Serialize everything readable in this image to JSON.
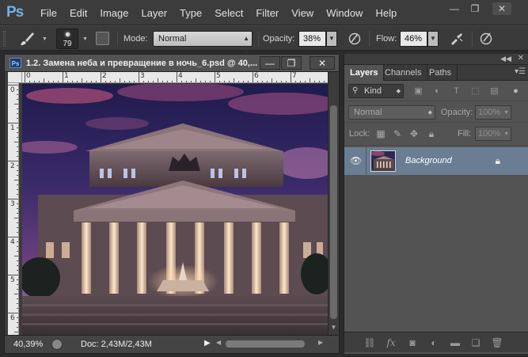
{
  "app": {
    "logo": "Ps",
    "menu": [
      "File",
      "Edit",
      "Image",
      "Layer",
      "Type",
      "Select",
      "Filter",
      "View",
      "Window",
      "Help"
    ],
    "window_controls": {
      "minimize": "—",
      "restore": "❐",
      "close": "✕"
    }
  },
  "options": {
    "brush_size": "79",
    "mode_label": "Mode:",
    "mode_value": "Normal",
    "opacity_label": "Opacity:",
    "opacity_value": "38%",
    "flow_label": "Flow:",
    "flow_value": "46%"
  },
  "document": {
    "title": "1.2. Замена неба и превращение в ночь_6.psd @ 40,...",
    "zoom": "40,39%",
    "doc_info": "Doc: 2,43M/2,43M",
    "ruler_top": [
      "0",
      "1",
      "2",
      "3",
      "4",
      "5",
      "6",
      "7"
    ],
    "ruler_left": [
      "0",
      "1",
      "2",
      "3",
      "4",
      "5",
      "6"
    ]
  },
  "layers_panel": {
    "tabs": [
      "Layers",
      "Channels",
      "Paths"
    ],
    "active_tab": "Layers",
    "kind_label": "Kind",
    "blend_mode": "Normal",
    "opacity_label": "Opacity:",
    "opacity_value": "100%",
    "lock_label": "Lock:",
    "fill_label": "Fill:",
    "fill_value": "100%",
    "layers": [
      {
        "name": "Background",
        "visible": true,
        "locked": true
      }
    ]
  },
  "colors": {
    "chrome_dark": "#3c3c3c",
    "panel": "#535353",
    "selected_layer": "#6a7d92",
    "ps_blue": "#6fb1e8"
  }
}
